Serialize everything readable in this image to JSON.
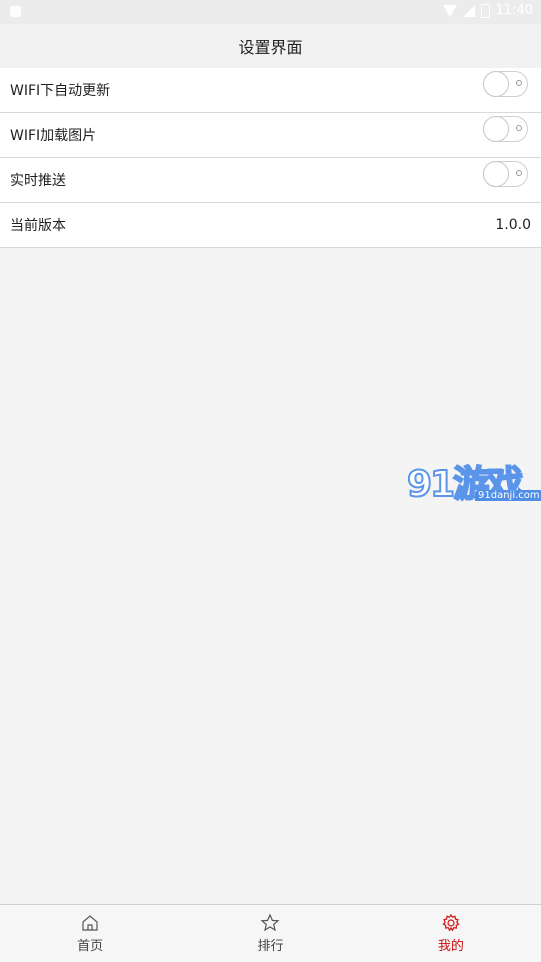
{
  "status_bar": {
    "time": "11:40"
  },
  "header": {
    "title": "设置界面"
  },
  "settings": {
    "items": [
      {
        "label": "WIFI下自动更新",
        "type": "toggle",
        "on": false
      },
      {
        "label": "WIFI加载图片",
        "type": "toggle",
        "on": false
      },
      {
        "label": "实时推送",
        "type": "toggle",
        "on": false
      },
      {
        "label": "当前版本",
        "type": "value",
        "value": "1.0.0"
      }
    ]
  },
  "watermark": {
    "logo_text": "91游戏",
    "site": "91danji.com"
  },
  "tabbar": {
    "tabs": [
      {
        "label": "首页",
        "icon": "home-icon",
        "active": false
      },
      {
        "label": "排行",
        "icon": "star-icon",
        "active": false
      },
      {
        "label": "我的",
        "icon": "gear-icon",
        "active": true
      }
    ],
    "active_color": "#cc1010"
  }
}
